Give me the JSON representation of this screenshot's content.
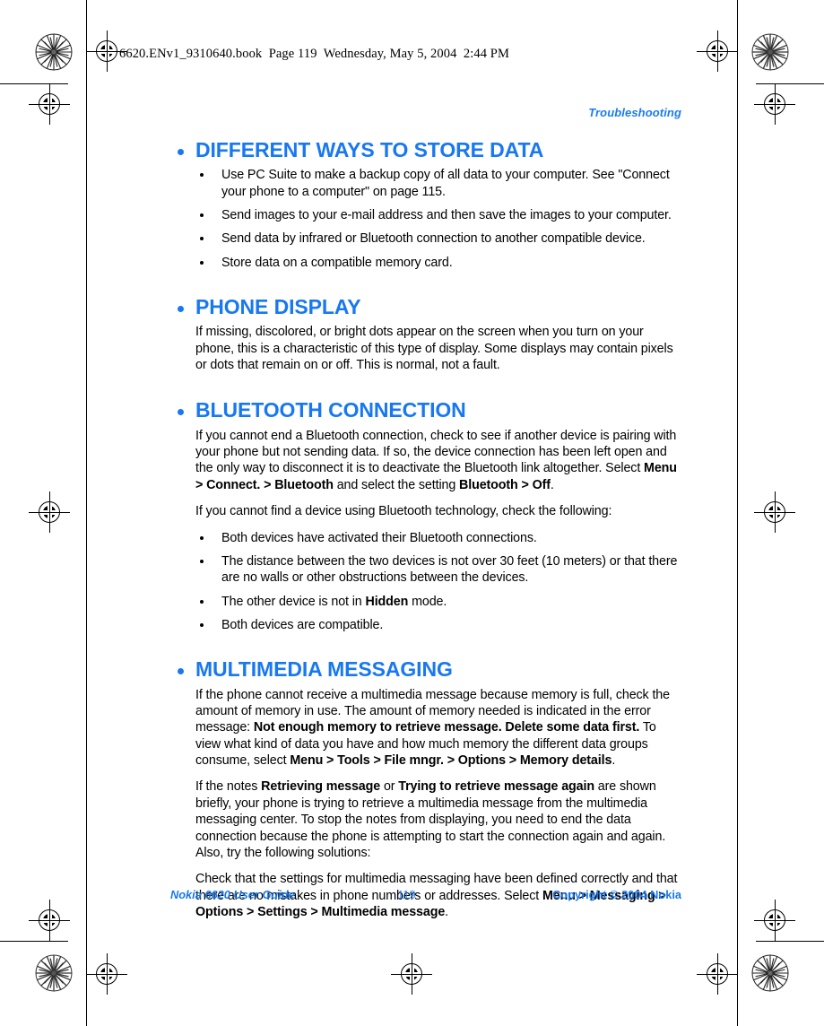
{
  "file_header": "6620.ENv1_9310640.book  Page 119  Wednesday, May 5, 2004  2:44 PM",
  "running_head": "Troubleshooting",
  "colors": {
    "heading_blue": "#1878F0",
    "footer_blue": "#1878F0",
    "body_black": "#000000"
  },
  "sections": [
    {
      "title": "DIFFERENT WAYS TO STORE DATA",
      "bullets": [
        "Use PC Suite to make a backup copy of all data to your computer. See \"Connect your phone to a computer\" on page 115.",
        "Send images to your e-mail address and then save the images to your computer.",
        "Send data by infrared or Bluetooth connection to another compatible device.",
        "Store data on a compatible memory card."
      ]
    },
    {
      "title": "PHONE DISPLAY",
      "paragraph": "If missing, discolored, or bright dots appear on the screen when you turn on your phone, this is a characteristic of this type of display. Some displays may contain pixels or dots that remain on or off. This is normal, not a fault."
    },
    {
      "title": "BLUETOOTH CONNECTION",
      "paragraph1_html": "If you cannot end a Bluetooth connection, check to see if another device is pairing with your phone but not sending data. If so, the device connection has been left open and the only way to disconnect it is to deactivate the Bluetooth link altogether. Select <b>Menu &gt; Connect. &gt; Bluetooth</b> and select the setting <b>Bluetooth &gt; Off</b>.",
      "paragraph2": "If you cannot find a device using Bluetooth technology, check the following:",
      "bullets_html": [
        "Both devices have activated their Bluetooth connections.",
        "The distance between the two devices is not over 30 feet (10 meters) or that there are no walls or other obstructions between the devices.",
        "The other device is not in <b>Hidden</b> mode.",
        "Both devices are compatible."
      ]
    },
    {
      "title": "MULTIMEDIA MESSAGING",
      "paragraph1_html": "If the phone cannot receive a multimedia message because memory is full, check the amount of memory in use. The amount of memory needed is indicated in the error message: <b>Not enough memory to retrieve message. Delete some data first.</b> To view what kind of data you have and how much memory the different data groups consume, select <b>Menu &gt; Tools &gt; File mngr. &gt; Options &gt; Memory details</b>.",
      "paragraph2_html": "If the notes <b>Retrieving message</b> or <b>Trying to retrieve message again</b> are shown briefly, your phone is trying to retrieve a multimedia message from the multimedia messaging center. To stop the notes from displaying, you need to end the data connection because the phone is attempting to start the connection again and again. Also, try the following solutions:",
      "paragraph3_html": "Check that the settings for multimedia messaging have been defined correctly and that there are no mistakes in phone numbers or addresses. Select <b>Menu &gt; Messaging &gt; Options &gt; Settings &gt; Multimedia message</b>."
    }
  ],
  "footer": {
    "left": "Nokia 6620 User Guide",
    "page_number": "119",
    "right": "Copyright © 2004 Nokia"
  }
}
